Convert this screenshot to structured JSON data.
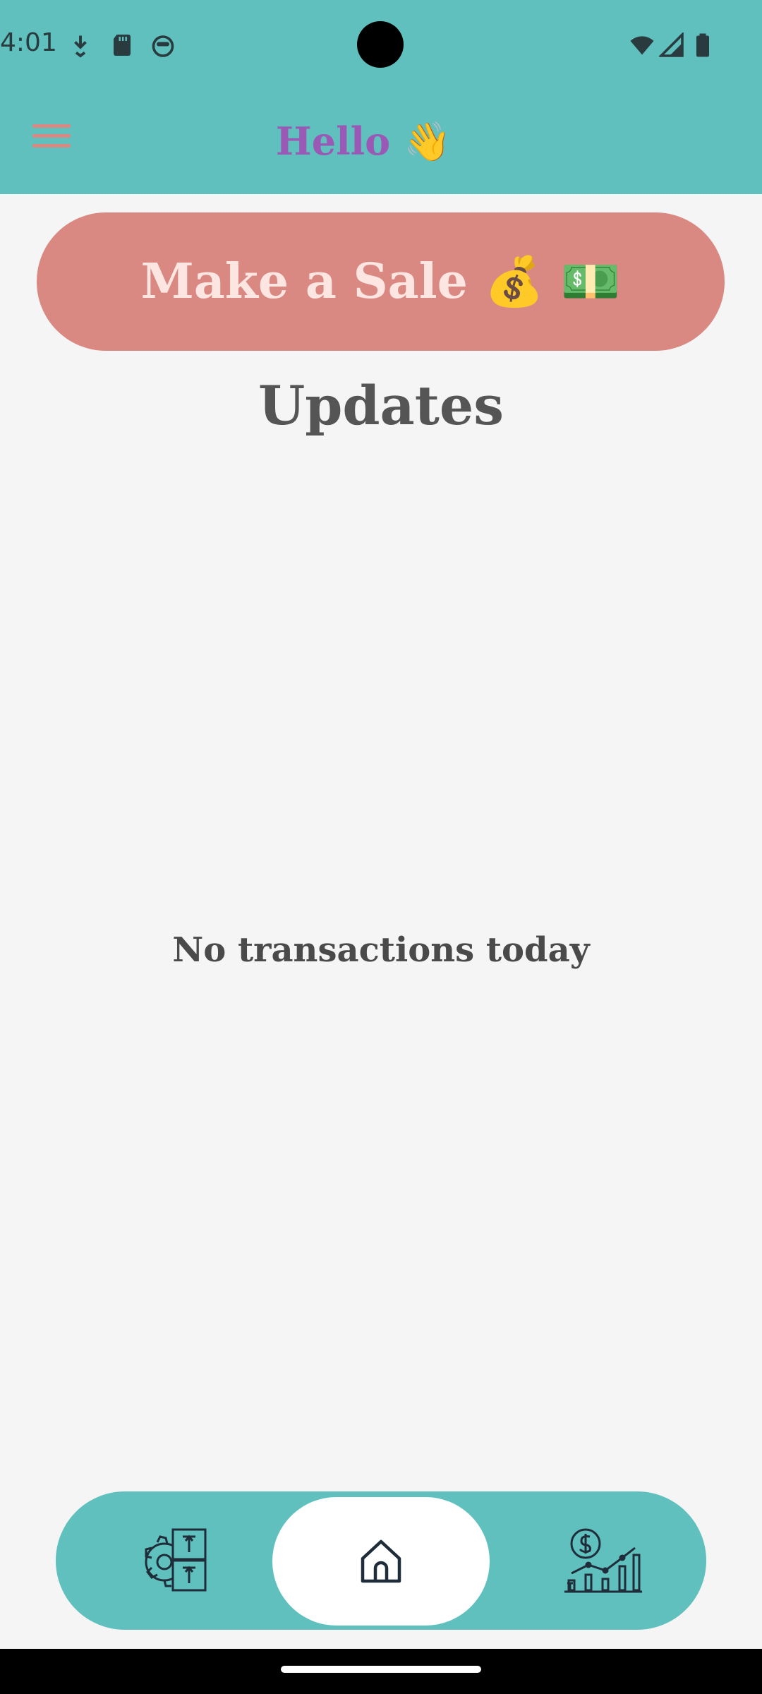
{
  "status_bar": {
    "time": "4:01",
    "left_icons": [
      "download-arrow-icon",
      "sd-card-icon",
      "android-face-icon"
    ],
    "right_icons": [
      "wifi-icon",
      "cell-signal-icon",
      "battery-icon"
    ]
  },
  "app_bar": {
    "title": "Hello 👋",
    "menu_icon": "hamburger-menu-icon"
  },
  "main": {
    "sale_button_label": "Make a Sale 💰 💵",
    "updates_title": "Updates",
    "empty_message": "No transactions today"
  },
  "bottom_nav": {
    "items": [
      {
        "icon": "inventory-settings-icon",
        "active": false
      },
      {
        "icon": "home-icon",
        "active": true
      },
      {
        "icon": "sales-analytics-icon",
        "active": false
      }
    ]
  },
  "colors": {
    "teal": "#5fc0be",
    "salmon": "#d98982",
    "purple": "#9b59b6",
    "background": "#f5f5f5"
  }
}
